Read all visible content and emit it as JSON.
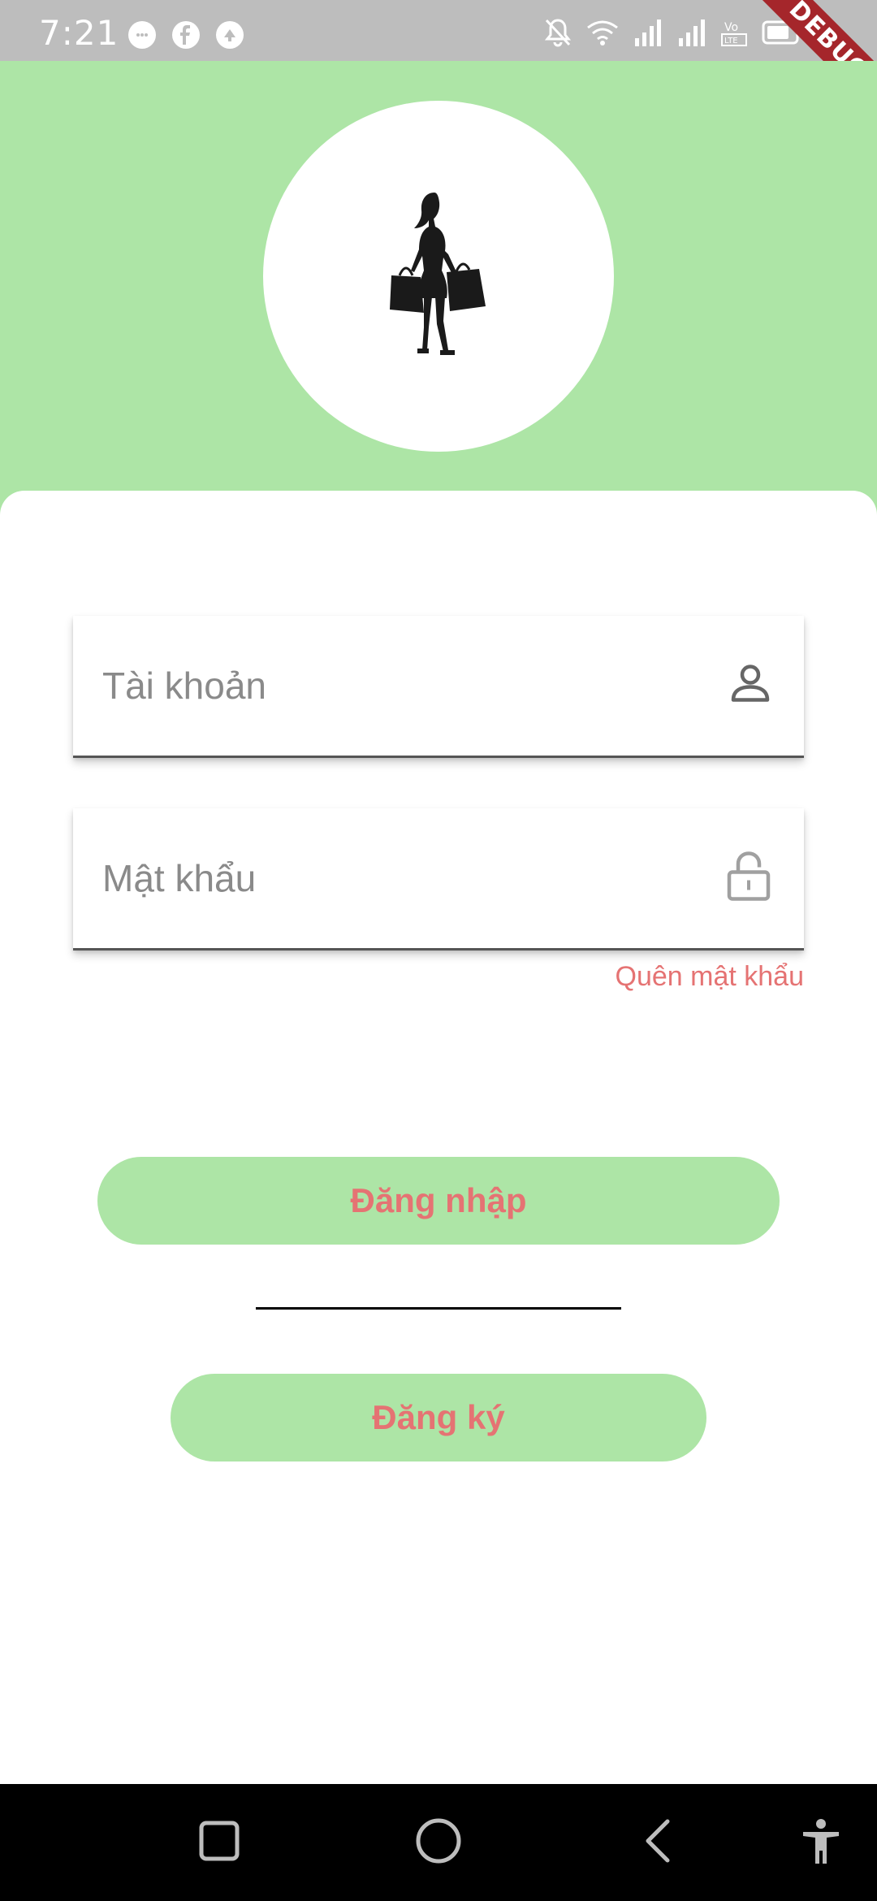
{
  "status_bar": {
    "time": "7:21",
    "left_icons": [
      "messenger-icon",
      "facebook-icon",
      "notification-app-icon"
    ],
    "right_icons": [
      "bell-off-icon",
      "wifi-icon",
      "signal-icon",
      "signal-icon",
      "volte-icon",
      "battery-icon"
    ],
    "debug_label": "DEBUG",
    "background": "#bdbdbd"
  },
  "header": {
    "background": "#ade5a6",
    "logo": "shopping-woman-silhouette"
  },
  "login_form": {
    "username_placeholder": "Tài khoản",
    "username_icon": "person-icon",
    "password_placeholder": "Mật khẩu",
    "password_icon": "lock-icon",
    "forgot_password": "Quên mật khẩu",
    "login_button": "Đăng nhập",
    "register_button": "Đăng ký",
    "button_color": "#ade5a6",
    "button_text_color": "#e57373"
  },
  "nav_bar": {
    "items": [
      "recent-apps-icon",
      "home-icon",
      "back-icon",
      "accessibility-icon"
    ]
  }
}
